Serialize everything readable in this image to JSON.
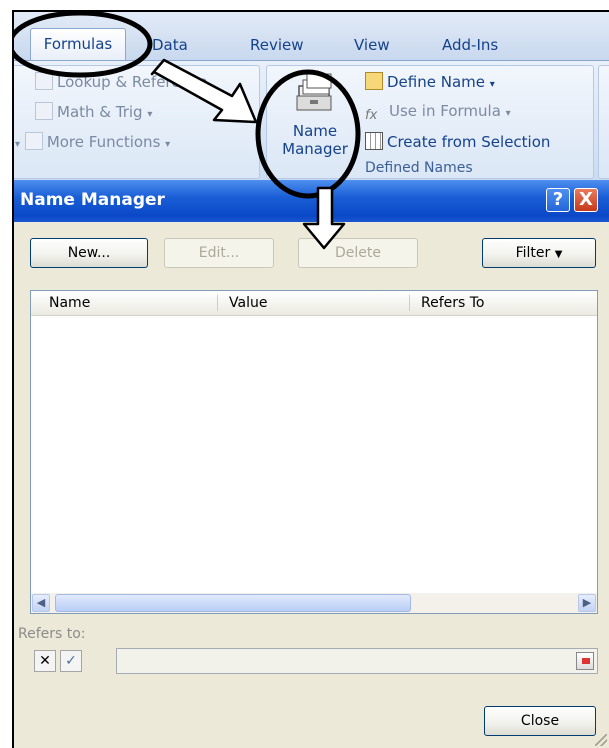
{
  "ribbon": {
    "tabs": [
      "Formulas",
      "Data",
      "Review",
      "View",
      "Add-Ins"
    ],
    "function_library": {
      "lookup": "Lookup & Reference",
      "math": "Math & Trig",
      "more": "More Functions"
    },
    "name_manager": "Name\nManager",
    "define_name": "Define Name",
    "use_in_formula": "Use in Formula",
    "create_from_selection": "Create from Selection",
    "group_label": "Defined Names"
  },
  "dialog": {
    "title": "Name Manager",
    "help_icon": "?",
    "close_icon": "X",
    "buttons": {
      "new": "New...",
      "edit": "Edit...",
      "delete": "Delete",
      "filter": "Filter"
    },
    "columns": [
      "Name",
      "Value",
      "Refers To"
    ],
    "refers_to_label": "Refers to:",
    "close_button": "Close"
  },
  "colors": {
    "titlebar": "#0b48c7",
    "annotation": "#000000"
  }
}
